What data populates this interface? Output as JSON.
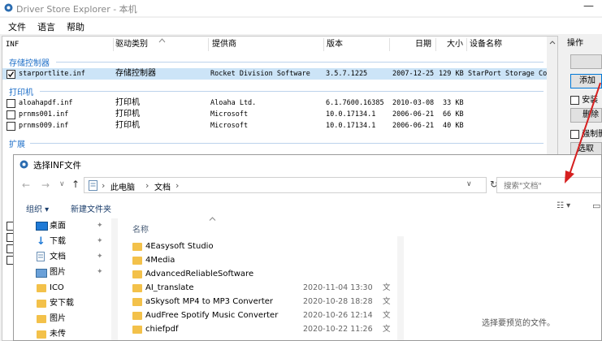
{
  "window": {
    "title": "Driver Store Explorer - 本机",
    "minimize_glyph": "—",
    "menu": [
      "文件",
      "语言",
      "帮助"
    ]
  },
  "list": {
    "columns": [
      "INF",
      "驱动类别",
      "提供商",
      "版本",
      "日期",
      "大小",
      "设备名称"
    ],
    "groups": [
      {
        "name": "存储控制器",
        "rows": [
          {
            "checked": true,
            "selected": true,
            "inf": "starportlite.inf",
            "class": "存储控制器",
            "provider": "Rocket Division Software",
            "version": "3.5.7.1225",
            "date": "2007-12-25",
            "size": "129 KB",
            "device": "StarPort Storage Con"
          }
        ]
      },
      {
        "name": "打印机",
        "rows": [
          {
            "checked": false,
            "selected": false,
            "inf": "aloahapdf.inf",
            "class": "打印机",
            "provider": "Aloaha Ltd.",
            "version": "6.1.7600.16385",
            "date": "2010-03-08",
            "size": "33 KB",
            "device": ""
          },
          {
            "checked": false,
            "selected": false,
            "inf": "prnms001.inf",
            "class": "打印机",
            "provider": "Microsoft",
            "version": "10.0.17134.1",
            "date": "2006-06-21",
            "size": "66 KB",
            "device": ""
          },
          {
            "checked": false,
            "selected": false,
            "inf": "prnms009.inf",
            "class": "打印机",
            "provider": "Microsoft",
            "version": "10.0.17134.1",
            "date": "2006-06-21",
            "size": "40 KB",
            "device": ""
          }
        ]
      },
      {
        "name": "扩展",
        "rows": []
      }
    ]
  },
  "ops": {
    "title": "操作",
    "add_label": "添加",
    "install_label": "安装",
    "delete_label": "删除",
    "force_label": "强制删",
    "select_label": "选取"
  },
  "dialog": {
    "title": "选择INF文件",
    "breadcrumb": [
      "此电脑",
      "文档"
    ],
    "search_placeholder": "搜索\"文档\"",
    "organize_label": "组织 ▾",
    "new_folder_label": "新建文件夹",
    "name_header": "名称",
    "preview_text": "选择要预览的文件。",
    "nav": [
      {
        "label": "桌面",
        "icon": "desktop-icon",
        "pinned": true
      },
      {
        "label": "下载",
        "icon": "download-arrow-icon",
        "pinned": true
      },
      {
        "label": "文档",
        "icon": "document-icon",
        "pinned": true
      },
      {
        "label": "图片",
        "icon": "pictures-icon",
        "pinned": true
      },
      {
        "label": "ICO",
        "icon": "folder-icon",
        "pinned": false
      },
      {
        "label": "安下载",
        "icon": "folder-icon",
        "pinned": false
      },
      {
        "label": "图片",
        "icon": "folder-icon",
        "pinned": false
      },
      {
        "label": "未传",
        "icon": "folder-icon",
        "pinned": false
      }
    ],
    "files": [
      {
        "name": "4Easysoft Studio",
        "date": "",
        "type": ""
      },
      {
        "name": "4Media",
        "date": "",
        "type": ""
      },
      {
        "name": "AdvancedReliableSoftware",
        "date": "",
        "type": ""
      },
      {
        "name": "AI_translate",
        "date": "2020-11-04 13:30",
        "type": "文"
      },
      {
        "name": "aSkysoft MP4 to MP3 Converter",
        "date": "2020-10-28 18:28",
        "type": "文"
      },
      {
        "name": "AudFree Spotify Music Converter",
        "date": "2020-10-26 12:14",
        "type": "文"
      },
      {
        "name": "chiefpdf",
        "date": "2020-10-22 11:26",
        "type": "文"
      }
    ]
  },
  "colors": {
    "accent": "#1e6fc8",
    "selection": "#cce4f7",
    "folder": "#f3c14a",
    "annotation_arrow": "#d62020"
  }
}
